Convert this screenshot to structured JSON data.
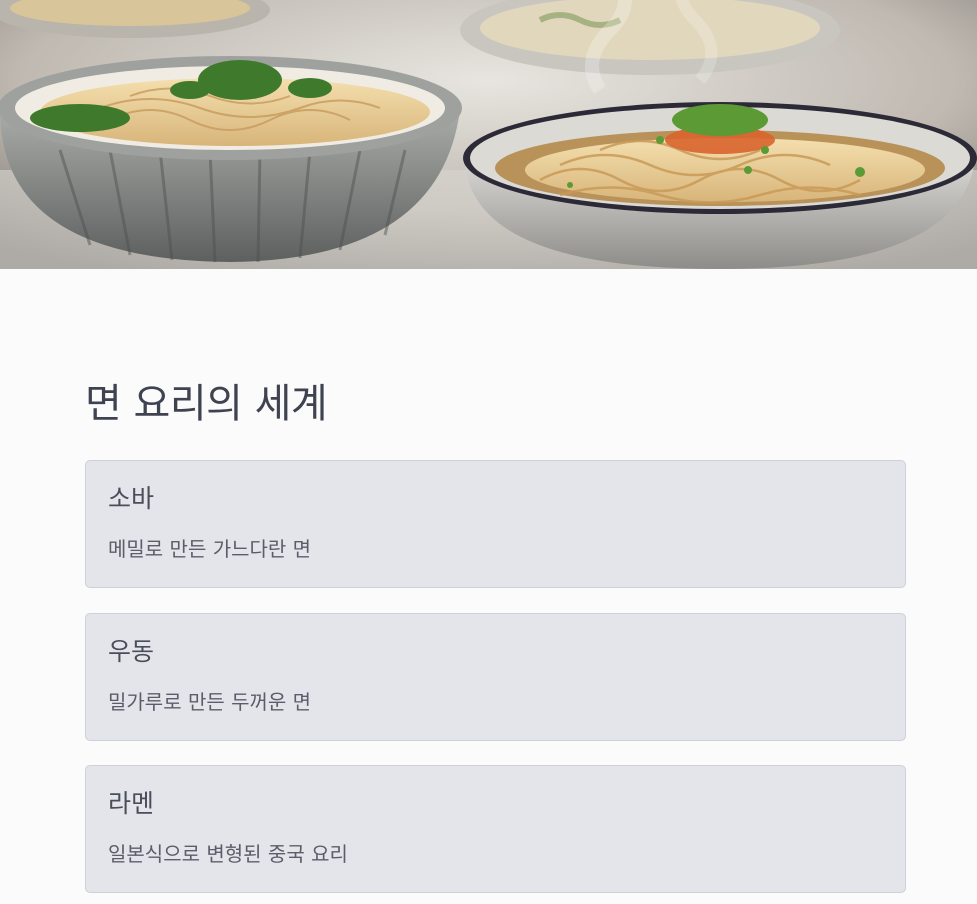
{
  "page": {
    "title": "면 요리의 세계"
  },
  "hero": {
    "image": "noodle-bowls-photo"
  },
  "noodles": [
    {
      "name": "소바",
      "description": "메밀로 만든 가느다란 면"
    },
    {
      "name": "우동",
      "description": "밀가루로 만든 두꺼운 면"
    },
    {
      "name": "라멘",
      "description": "일본식으로 변형된 중국 요리"
    }
  ],
  "colors": {
    "card_background": "#e4e5ea",
    "card_border": "#cfd1d8",
    "title_text": "#3f4350",
    "page_background": "#fbfbfc"
  }
}
